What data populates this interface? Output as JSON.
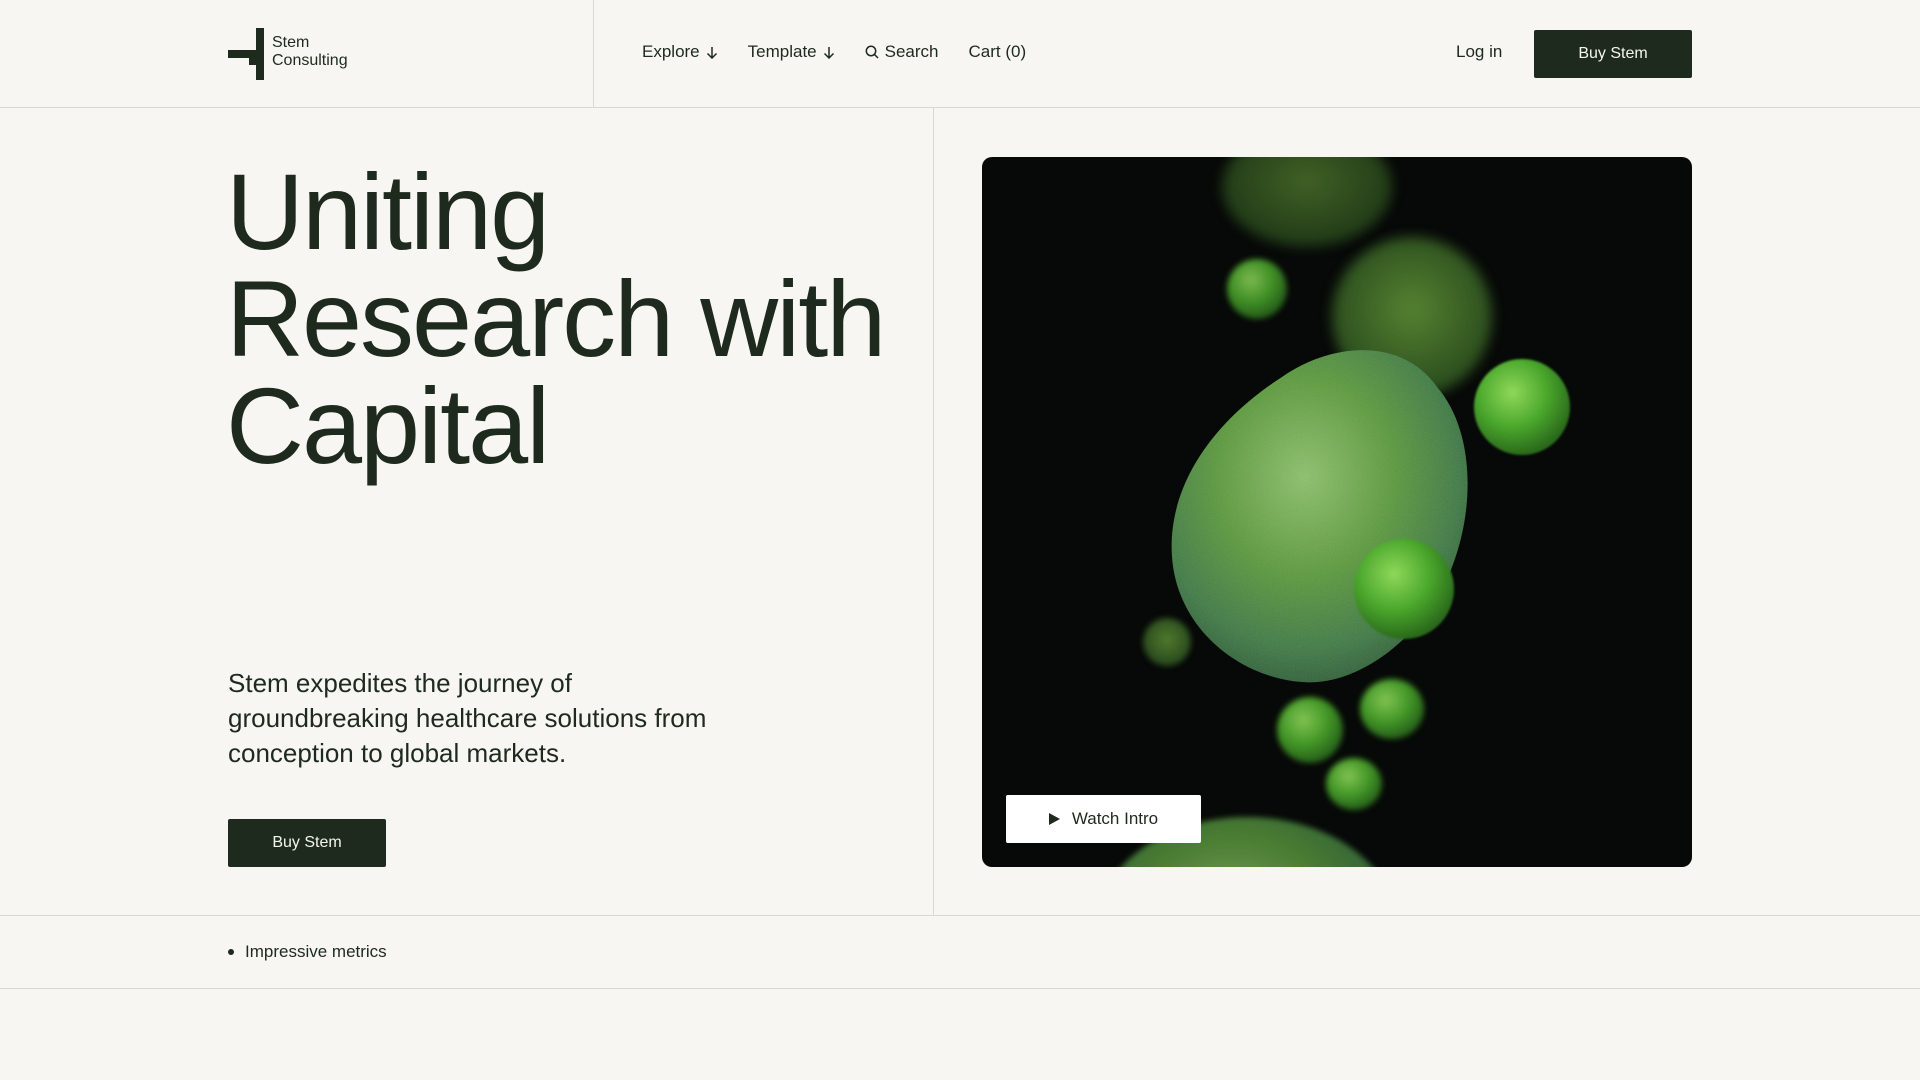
{
  "brand": {
    "name_line1": "Stem",
    "name_line2": "Consulting"
  },
  "nav": {
    "explore": "Explore",
    "template": "Template",
    "search": "Search",
    "cart": "Cart (0)"
  },
  "header": {
    "login": "Log in",
    "cta": "Buy Stem"
  },
  "hero": {
    "title_line1": "Uniting",
    "title_line2": "Research with",
    "title_line3": "Capital",
    "subtitle": "Stem expedites the journey of groundbreaking healthcare solutions from conception to global markets.",
    "cta": "Buy Stem",
    "watch_label": "Watch Intro"
  },
  "metrics": {
    "label": "Impressive metrics"
  },
  "colors": {
    "ink": "#1e2a1e",
    "background": "#f7f6f2",
    "button": "#1f2a1f",
    "media_bg": "#070908",
    "cell_green": "#4a9a2e"
  },
  "icons": [
    "logo-mark",
    "arrow-down-icon",
    "search-icon",
    "play-icon",
    "bullet-icon"
  ]
}
